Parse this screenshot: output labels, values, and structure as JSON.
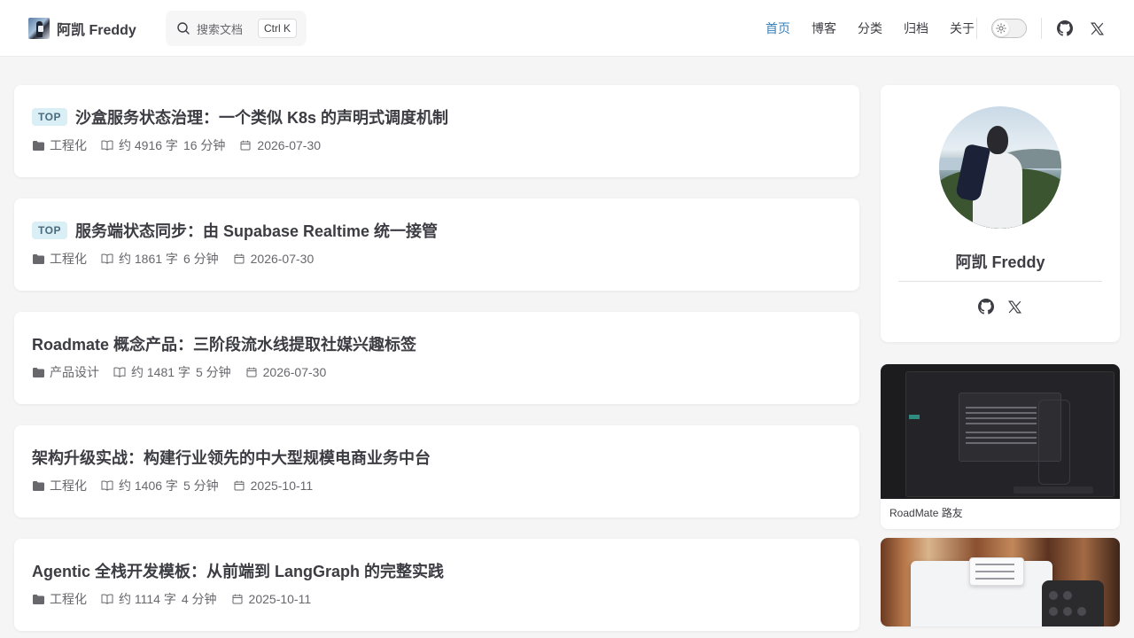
{
  "header": {
    "site_name": "阿凯 Freddy",
    "search": {
      "placeholder": "搜索文档",
      "shortcut": "Ctrl K"
    },
    "nav": [
      {
        "label": "首页",
        "active": true
      },
      {
        "label": "博客",
        "active": false
      },
      {
        "label": "分类",
        "active": false
      },
      {
        "label": "归档",
        "active": false
      },
      {
        "label": "关于",
        "active": false
      }
    ],
    "icons": {
      "theme": "sun-icon",
      "github": "github-icon",
      "x": "x-icon"
    },
    "accent_color": "#3a7fb8"
  },
  "posts": [
    {
      "pinned": true,
      "badge": "TOP",
      "title": "沙盒服务状态治理：一个类似 K8s 的声明式调度机制",
      "category": "工程化",
      "words": "约 4916 字",
      "read_time": "16 分钟",
      "date": "2026-07-30"
    },
    {
      "pinned": true,
      "badge": "TOP",
      "title": "服务端状态同步：由 Supabase Realtime 统一接管",
      "category": "工程化",
      "words": "约 1861 字",
      "read_time": "6 分钟",
      "date": "2026-07-30"
    },
    {
      "pinned": false,
      "badge": "",
      "title": "Roadmate 概念产品：三阶段流水线提取社媒兴趣标签",
      "category": "产品设计",
      "words": "约 1481 字",
      "read_time": "5 分钟",
      "date": "2026-07-30"
    },
    {
      "pinned": false,
      "badge": "",
      "title": "架构升级实战：构建行业领先的中大型规模电商业务中台",
      "category": "工程化",
      "words": "约 1406 字",
      "read_time": "5 分钟",
      "date": "2025-10-11"
    },
    {
      "pinned": false,
      "badge": "",
      "title": "Agentic 全栈开发模板：从前端到 LangGraph 的完整实践",
      "category": "工程化",
      "words": "约 1114 字",
      "read_time": "4 分钟",
      "date": "2025-10-11"
    }
  ],
  "sidebar": {
    "profile": {
      "name": "阿凯 Freddy"
    },
    "projects": [
      {
        "caption": "RoadMate 路友"
      }
    ]
  }
}
